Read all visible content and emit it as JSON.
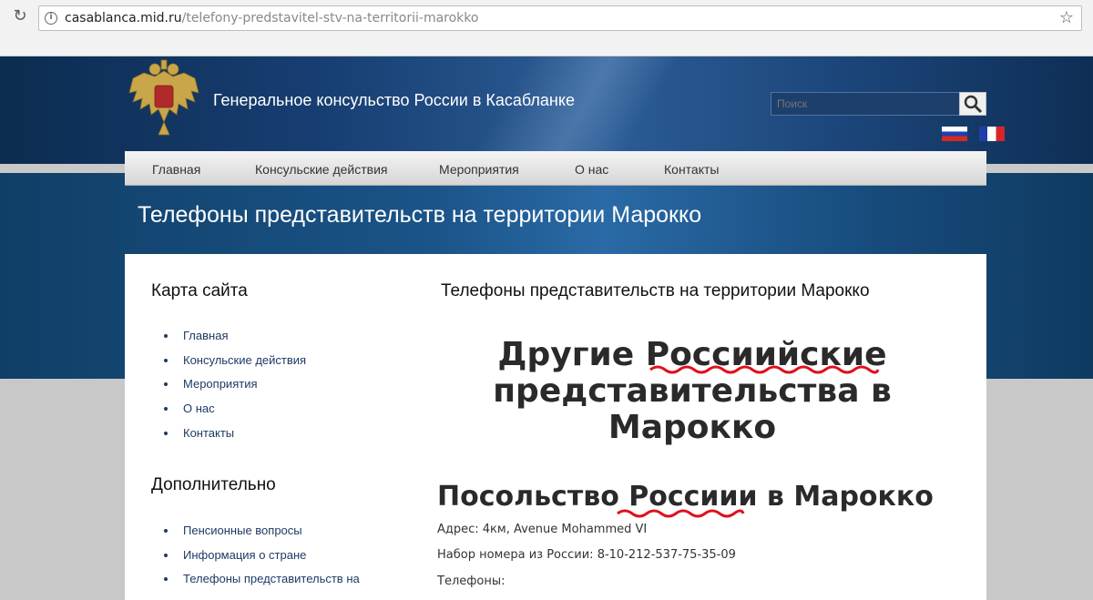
{
  "browser": {
    "url_host": "casablanca.mid.ru",
    "url_path": "/telefony-predstavitel-stv-na-territorii-marokko"
  },
  "header": {
    "site_title": "Генеральное консульство России в Касабланке",
    "search_placeholder": "Поиск"
  },
  "nav": {
    "items": [
      "Главная",
      "Консульские действия",
      "Мероприятия",
      "О нас",
      "Контакты"
    ]
  },
  "page_title": "Телефоны представительств на территории Марокко",
  "sidebar": {
    "sitemap_heading": "Карта сайта",
    "sitemap_items": [
      "Главная",
      "Консульские действия",
      "Мероприятия",
      "О нас",
      "Контакты"
    ],
    "extra_heading": "Дополнительно",
    "extra_items": [
      "Пенсионные вопросы",
      "Информация о стране",
      "Телефоны представительств на"
    ]
  },
  "main": {
    "heading": "Телефоны представительств на территории Марокко",
    "big_heading_line1": "Другие Россиийские",
    "big_heading_line2": "представительства в",
    "big_heading_line3": "Марокко",
    "embassy_heading": "Посольство Россиии в Марокко",
    "address": "Адрес: 4км, Avenue Mohammed VI",
    "dial": "Набор номера из России: 8-10-212-537-75-35-09",
    "phones": "Телефоны:"
  }
}
